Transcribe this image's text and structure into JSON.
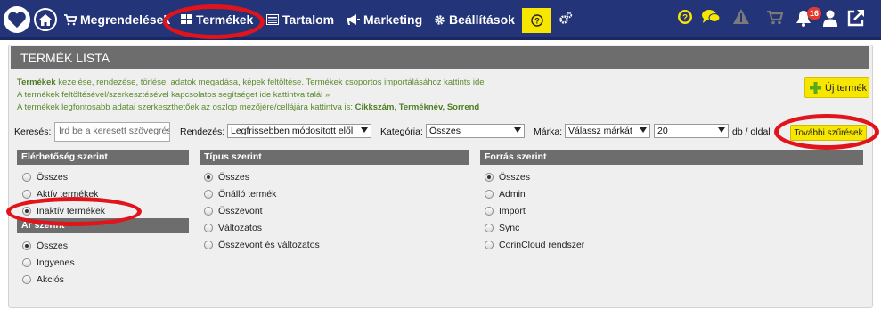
{
  "nav": {
    "items": [
      "Megrendelések",
      "Termékek",
      "Tartalom",
      "Marketing",
      "Beállítások"
    ],
    "notification_count": "16"
  },
  "panel": {
    "title": "TERMÉK LISTA",
    "info_line1_bold": "Termékek",
    "info_line1_rest": " kezelése, rendezése, törlése, adatok megadása, képek feltöltése. Termékek csoportos importálásához kattints ide",
    "info_line2": "A termékek feltöltésével/szerkesztésével kapcsolatos segítséget ide kattintva talál »",
    "info_line3_prefix": "A termékek legfontosabb adatai szerkeszthetőek az oszlop mezőjére/cellájára kattintva is: ",
    "info_line3_bold": "Cikkszám, Terméknév, Sorrend",
    "new_product_label": "Új termék",
    "more_filters_label": "További szűrések"
  },
  "filters": {
    "search_label": "Keresés:",
    "search_placeholder": "Írd be a keresett szövegrészt",
    "sort_label": "Rendezés:",
    "sort_value": "Legfrissebben módosított elől",
    "category_label": "Kategória:",
    "category_value": "Összes",
    "brand_label": "Márka:",
    "brand_value": "Válassz márkát",
    "per_page_value": "20",
    "per_page_suffix": "db / oldal"
  },
  "groups": {
    "availability": {
      "title": "Elérhetőség szerint",
      "options": [
        "Összes",
        "Aktív termékek",
        "Inaktív termékek"
      ],
      "selected": 2
    },
    "price": {
      "title": "Ár szerint",
      "options": [
        "Összes",
        "Ingyenes",
        "Akciós"
      ],
      "selected": 0
    },
    "type": {
      "title": "Típus szerint",
      "options": [
        "Összes",
        "Önálló termék",
        "Összevont",
        "Változatos",
        "Összevont és változatos"
      ],
      "selected": 0
    },
    "source": {
      "title": "Forrás szerint",
      "options": [
        "Összes",
        "Admin",
        "Import",
        "Sync",
        "CorinCloud rendszer"
      ],
      "selected": 0
    }
  },
  "colors": {
    "nav_bg": "#233478",
    "accent_yellow": "#f6e600",
    "annotation_red": "#e1141b",
    "info_green": "#5c8a2e"
  }
}
